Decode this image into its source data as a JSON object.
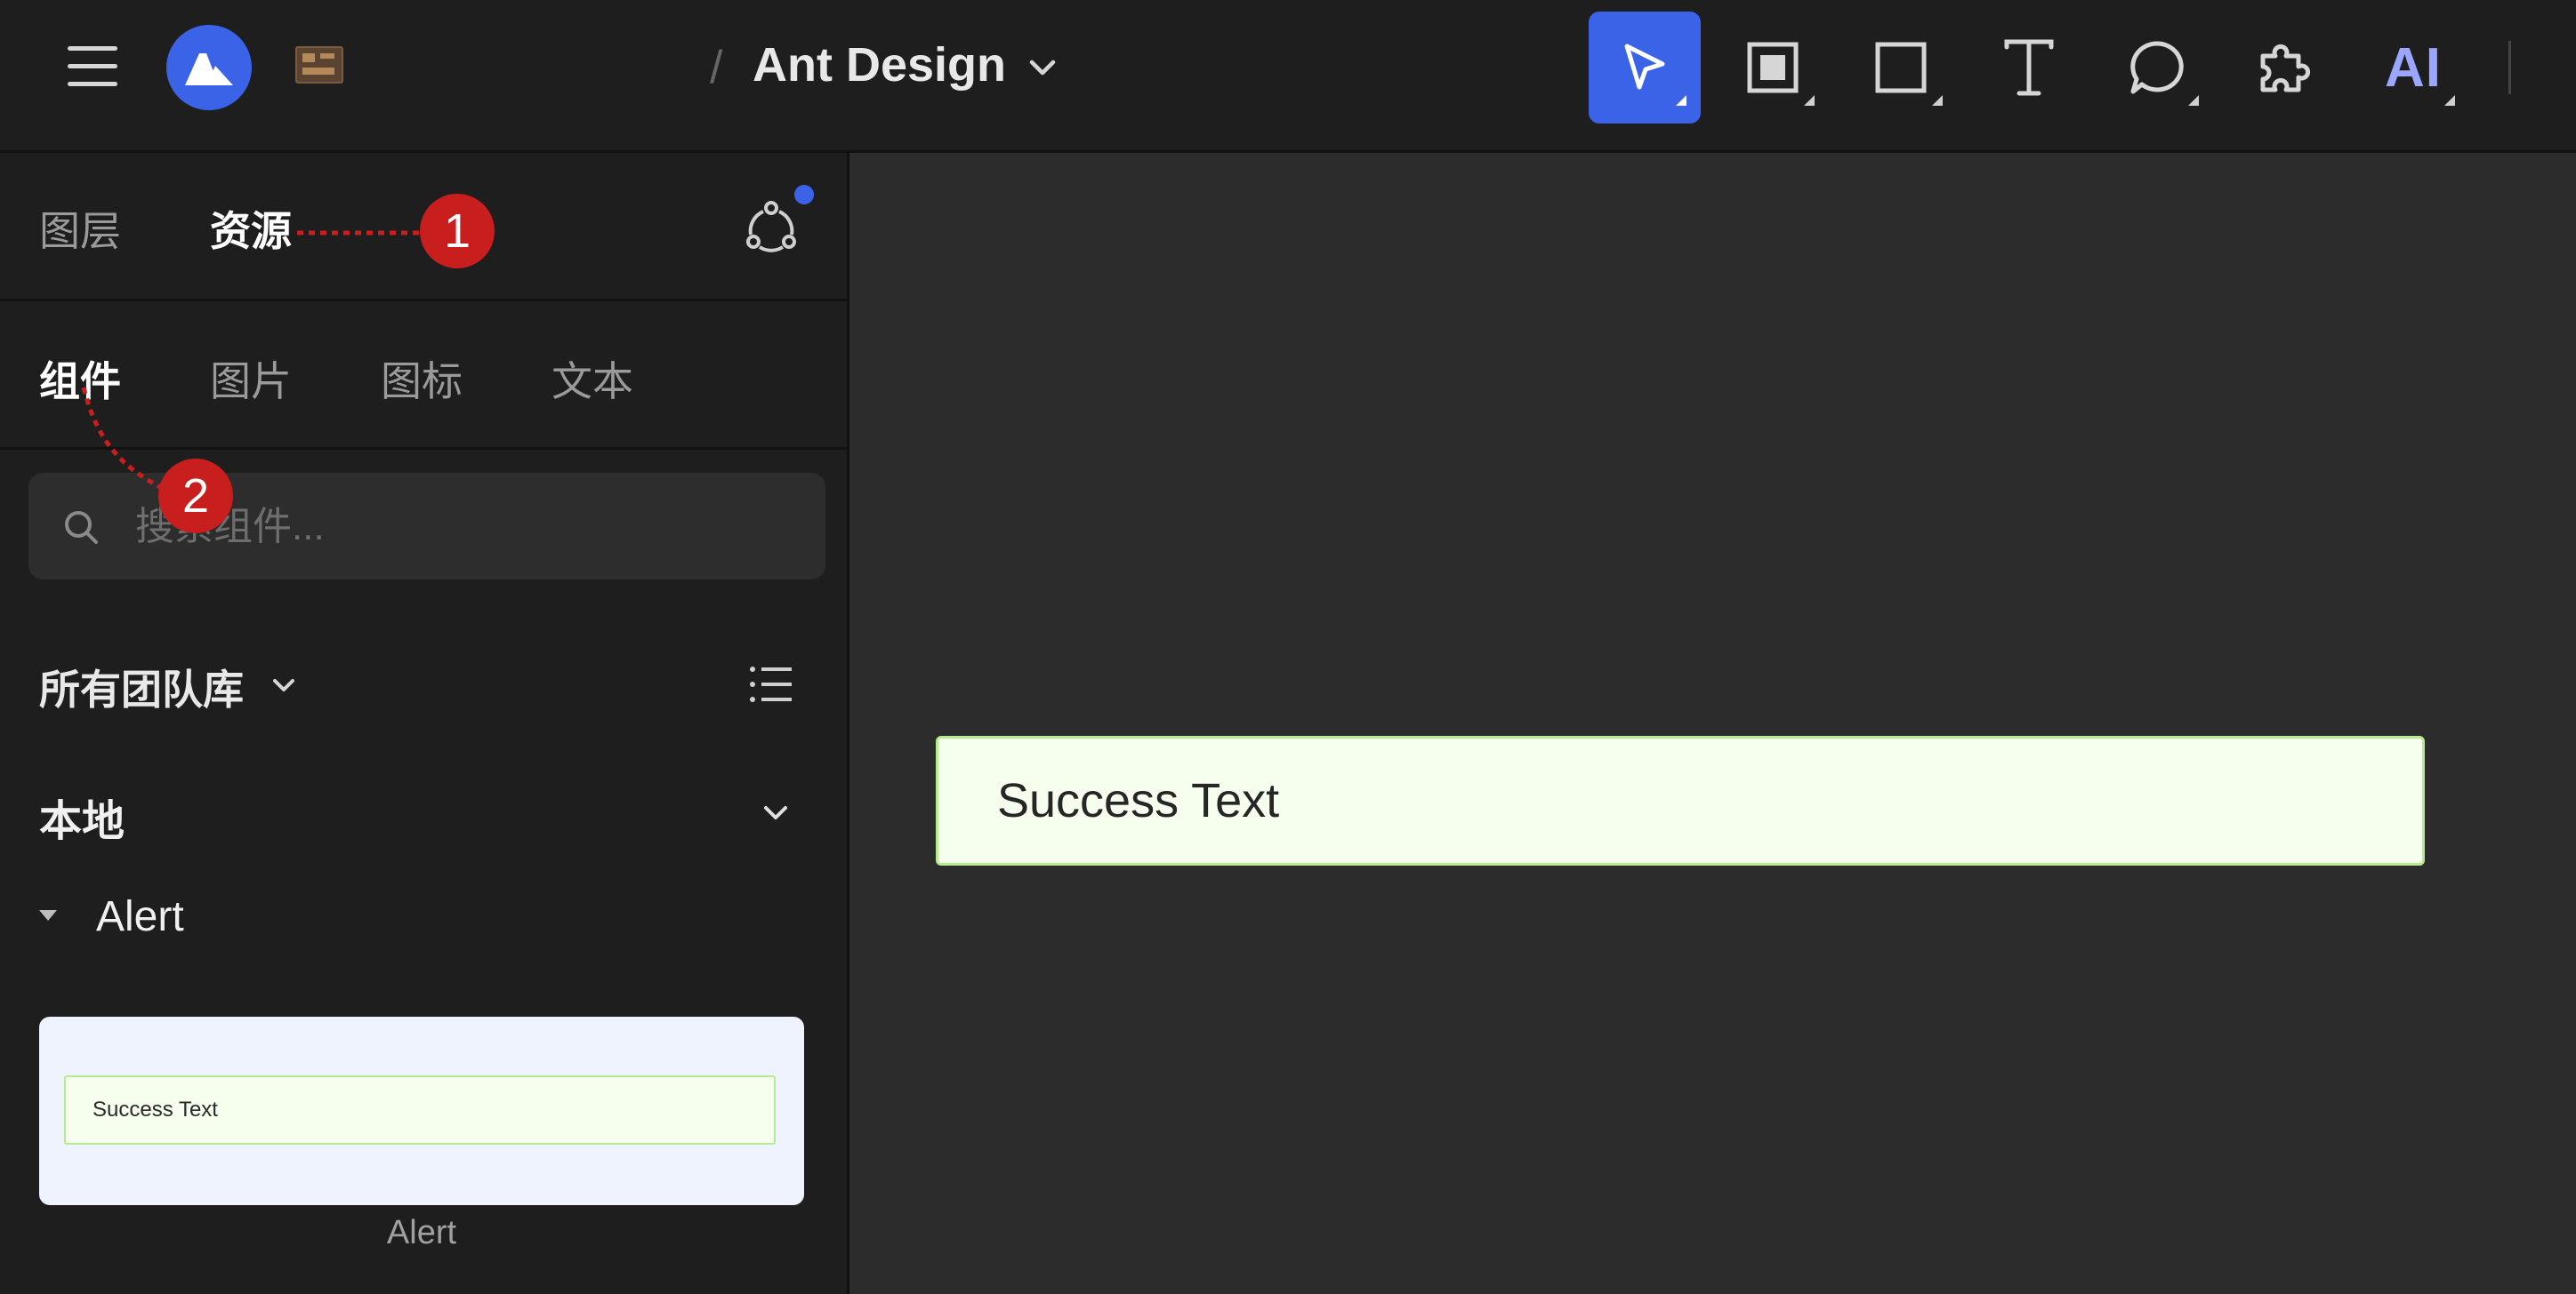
{
  "topbar": {
    "breadcrumb_separator": "/",
    "document_title": "Ant Design",
    "tools": [
      {
        "name": "select-tool",
        "icon": "pointer-icon",
        "active": true
      },
      {
        "name": "frame-tool",
        "icon": "frame-icon",
        "active": false
      },
      {
        "name": "rectangle-tool",
        "icon": "rectangle-icon",
        "active": false
      },
      {
        "name": "text-tool",
        "icon": "text-icon",
        "active": false
      },
      {
        "name": "comment-tool",
        "icon": "comment-icon",
        "active": false
      },
      {
        "name": "plugin-tool",
        "icon": "puzzle-icon",
        "active": false
      },
      {
        "name": "ai-tool",
        "label": "AI",
        "active": false
      }
    ],
    "accent_color": "#3a63e8"
  },
  "sidebar": {
    "primary_tabs": [
      {
        "label": "图层",
        "active": false
      },
      {
        "label": "资源",
        "active": true
      }
    ],
    "secondary_tabs": [
      {
        "label": "组件",
        "active": true
      },
      {
        "label": "图片",
        "active": false
      },
      {
        "label": "图标",
        "active": false
      },
      {
        "label": "文本",
        "active": false
      }
    ],
    "search": {
      "placeholder": "搜索组件...",
      "value": ""
    },
    "library_selector": "所有团队库",
    "local_section": "本地",
    "group_title": "Alert",
    "component_card": {
      "preview_text": "Success Text",
      "label": "Alert"
    }
  },
  "annotations": [
    {
      "number": "1",
      "target": "资源"
    },
    {
      "number": "2",
      "target": "组件"
    }
  ],
  "canvas": {
    "alert_text": "Success Text",
    "alert_background": "#f6ffed",
    "alert_border": "#b7eb8f"
  }
}
